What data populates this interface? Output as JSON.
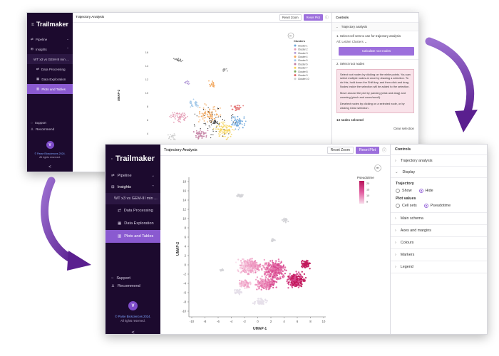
{
  "brand": "Trailmaker",
  "nav": {
    "pipeline": "Pipeline",
    "insights": "Insights",
    "experiment": "WT x3 vs GEM-III min ...",
    "data_processing": "Data Processing",
    "data_exploration": "Data Exploration",
    "plots_tables": "Plots and Tables",
    "support": "Support",
    "recommend": "Recommend",
    "avatar_letter": "V",
    "footer_brand": "© Parse Biosciences 2024.",
    "footer_rights": "All rights reserved.",
    "collapse": "<"
  },
  "toolbar": {
    "title": "Trajectory Analysis",
    "reset_zoom": "Reset Zoom",
    "reset_plot": "Reset Plot"
  },
  "back_panel": {
    "controls": "Controls",
    "trajectory_analysis": "Trajectory analysis",
    "step1": "1. Select cell sets to use for trajectory analysis",
    "step1_value": "All: Leiden Clusters",
    "calculate": "Calculate root nodes",
    "step2": "2. Select root nodes",
    "info1": "Select root nodes by clicking on the white points. You can select multiple nodes at once by drawing a selection. To do this, hold down the Shift key, and then click and drag. Nodes inside the selection will be added to the selection.",
    "info2": "Move around the plot by panning (click and drag) and zooming (pinch and zoom/scroll).",
    "info3": "Deselect nodes by clicking on a selected node, or by clicking Clear selection.",
    "nodes_selected": "13 nodes selected",
    "clear_selection": "Clear selection"
  },
  "back_plot": {
    "legend_title": "Clusters",
    "legend_items": [
      "Cluster 1",
      "Cluster 2",
      "Cluster 3",
      "Cluster 4",
      "Cluster 5",
      "Cluster 6",
      "Cluster 7",
      "Cluster 8",
      "Cluster 9",
      "Cluster 10"
    ],
    "legend_colors": [
      "#6fa8dc",
      "#e49bb4",
      "#b59ed8",
      "#f2a65a",
      "#9fc5e8",
      "#c27ba0",
      "#f6d35b",
      "#7aa85a",
      "#e06666",
      "#cccccc"
    ],
    "y_ticks": [
      "16",
      "14",
      "12",
      "10",
      "8",
      "6",
      "4",
      "2"
    ],
    "y_label": "UMAP-2"
  },
  "front_panel": {
    "controls": "Controls",
    "trajectory_analysis": "Trajectory analysis",
    "display": "Display",
    "trajectory": "Trajectory",
    "show": "Show",
    "hide": "Hide",
    "plot_values": "Plot values",
    "cell_sets": "Cell sets",
    "pseudotime": "Pseudotime",
    "main_schema": "Main schema",
    "axes_margins": "Axes and margins",
    "colours": "Colours",
    "markers": "Markers",
    "legend": "Legend"
  },
  "front_plot": {
    "legend_title": "Pseudotime",
    "legend_ticks": [
      "20",
      "15",
      "10",
      "5"
    ],
    "y_ticks": [
      "18",
      "16",
      "14",
      "12",
      "10",
      "8",
      "6",
      "4",
      "2",
      "0",
      "-2",
      "-4",
      "-6",
      "-8",
      "-10"
    ],
    "x_ticks": [
      "-10",
      "-8",
      "-6",
      "-4",
      "-2",
      "0",
      "2",
      "4",
      "6",
      "8",
      "10"
    ],
    "x_label": "UMAP-1",
    "y_label": "UMAP-2"
  },
  "colors": {
    "sidebar": "#1c0a2e",
    "accent": "#9c6fdc",
    "active_nav": "#8a5ad0",
    "arrow": "#7a3fb0",
    "pseudotime_low": "#f0c6dc",
    "pseudotime_high": "#c2185b"
  },
  "icons": [
    "trailmaker-logo-icon",
    "pipeline-icon",
    "insights-icon",
    "data-processing-icon",
    "data-exploration-icon",
    "plots-icon",
    "support-icon",
    "recommend-icon",
    "more-icon",
    "info-icon"
  ]
}
